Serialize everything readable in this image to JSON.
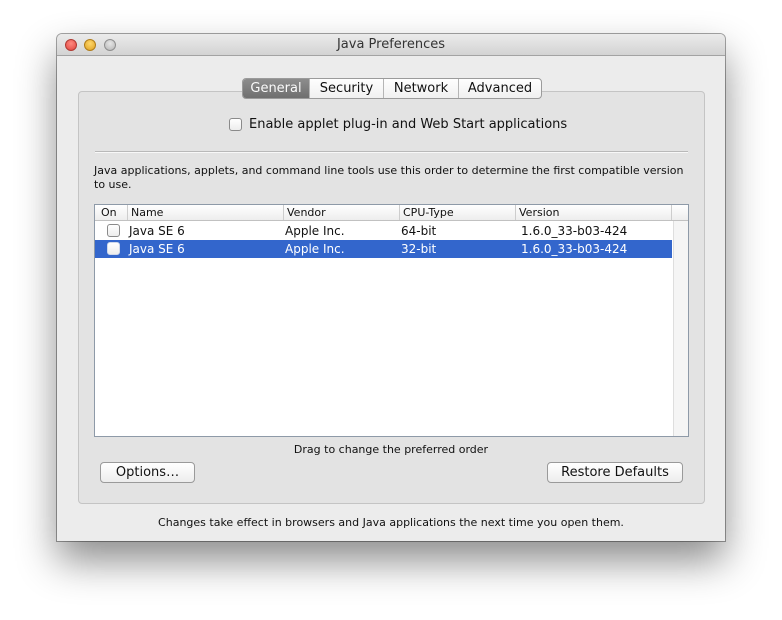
{
  "window": {
    "title": "Java Preferences"
  },
  "tabs": [
    {
      "label": "General",
      "active": true
    },
    {
      "label": "Security",
      "active": false
    },
    {
      "label": "Network",
      "active": false
    },
    {
      "label": "Advanced",
      "active": false
    }
  ],
  "general": {
    "enable_label": "Enable applet plug-in and Web Start applications",
    "enable_checked": false,
    "description": "Java applications, applets, and command line tools use this order to determine the first compatible version to use.",
    "table": {
      "columns": [
        "On",
        "Name",
        "Vendor",
        "CPU-Type",
        "Version"
      ],
      "rows": [
        {
          "on": false,
          "name": "Java SE 6",
          "vendor": "Apple Inc.",
          "cpu": "64-bit",
          "version": "1.6.0_33-b03-424",
          "selected": false
        },
        {
          "on": false,
          "name": "Java SE 6",
          "vendor": "Apple Inc.",
          "cpu": "32-bit",
          "version": "1.6.0_33-b03-424",
          "selected": true
        }
      ]
    },
    "drag_hint": "Drag to change the preferred order",
    "options_button": "Options…",
    "restore_button": "Restore Defaults"
  },
  "footer": "Changes take effect in browsers and Java applications the next time you open them.",
  "colors": {
    "selection": "#3366cc",
    "window_bg": "#ececec"
  }
}
